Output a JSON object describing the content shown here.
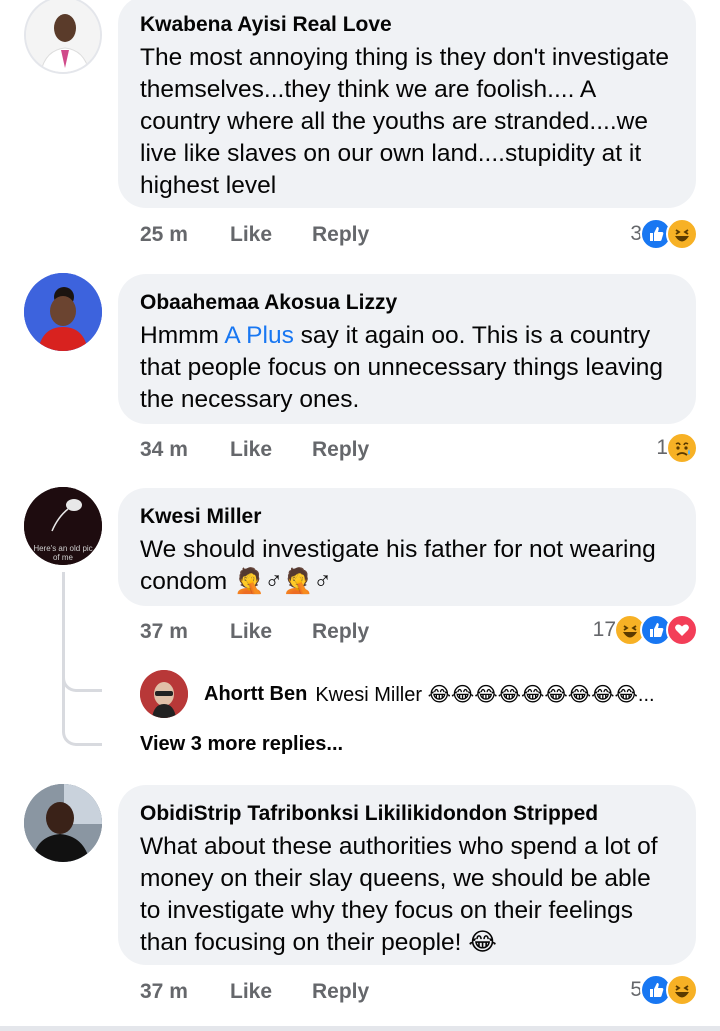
{
  "comments": [
    {
      "author": "Kwabena Ayisi Real Love",
      "text": "The most annoying thing is they don't investigate themselves...they think we are foolish.... A country where all the youths are stranded....we live like slaves on our own land....stupidity at it highest level",
      "time": "25 m",
      "like_label": "Like",
      "reply_label": "Reply",
      "reaction_count": "3",
      "reactions": [
        "like",
        "haha"
      ]
    },
    {
      "author": "Obaahemaa Akosua Lizzy",
      "text_before": "Hmmm ",
      "mention": "A Plus",
      "text_after": " say it again oo. This is a country that people focus on unnecessary things leaving the necessary ones.",
      "time": "34 m",
      "like_label": "Like",
      "reply_label": "Reply",
      "reaction_count": "1",
      "reactions": [
        "sad"
      ]
    },
    {
      "author": "Kwesi Miller",
      "text": "We should investigate his father for not wearing condom 🤦♂🤦♂",
      "avatar_caption": "Here's an old pic of me",
      "time": "37 m",
      "like_label": "Like",
      "reply_label": "Reply",
      "reaction_count": "17",
      "reactions": [
        "haha",
        "like",
        "love"
      ],
      "reply": {
        "author": "Ahortt Ben",
        "text": "Kwesi Miller 😂😂😂😂😂😂😂😂😂..."
      },
      "more_replies": "View 3 more replies..."
    },
    {
      "author": "ObidiStrip Tafribonksi Likilikidondon Stripped",
      "text": "What about these authorities who spend a lot of money on their slay queens, we should be able to investigate why they focus on their feelings than focusing on their people! 😂",
      "time": "37 m",
      "like_label": "Like",
      "reply_label": "Reply",
      "reaction_count": "5",
      "reactions": [
        "like",
        "haha"
      ]
    }
  ],
  "colors": {
    "bubble": "#f0f2f5",
    "meta_text": "#65676b",
    "mention": "#1877f2",
    "like": "#1877f2",
    "haha": "#f7b125",
    "love": "#f33e58"
  }
}
